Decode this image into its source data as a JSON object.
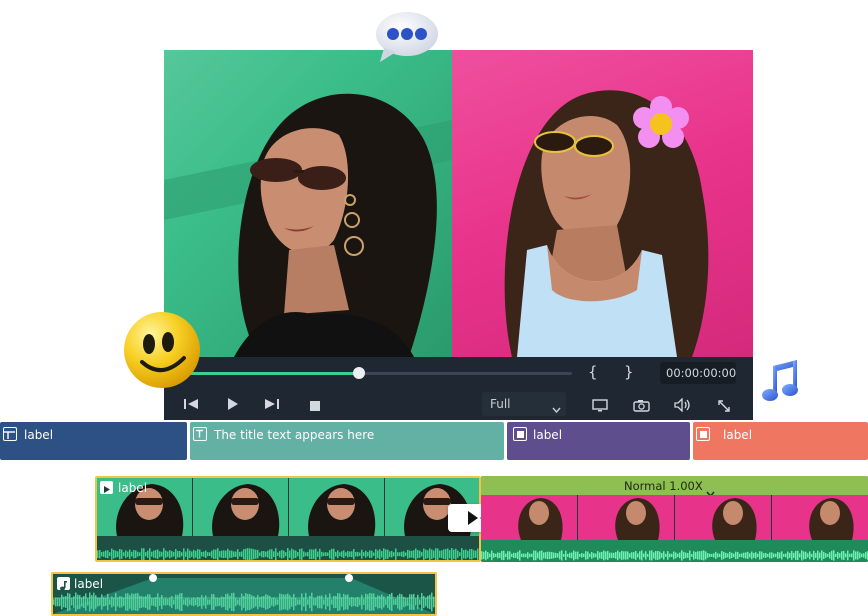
{
  "player": {
    "timecode": "00:00:00:00",
    "zoom_value": "Full",
    "mark_in_label": "{",
    "mark_out_label": "}",
    "progress": 0.45,
    "icons": [
      "step-back-icon",
      "play-icon",
      "step-forward-icon",
      "stop-icon",
      "chevron-down-icon",
      "display-icon",
      "camera-icon",
      "volume-icon",
      "fullscreen-icon"
    ]
  },
  "stickers": [
    "speech-bubble-sticker",
    "flower-sticker",
    "smiley-sticker",
    "music-note-sticker"
  ],
  "tracks": {
    "row1": [
      {
        "label": "label",
        "color": "#2d5185"
      },
      {
        "label": "The title text appears here",
        "color": "#63b0a4"
      },
      {
        "label": "label",
        "color": "#5e4e8e"
      },
      {
        "label": "label",
        "color": "#ef7762"
      }
    ],
    "video_clip_label": "label",
    "speed_label": "Normal 1.00X",
    "audio_clip_label": "label"
  },
  "colors": {
    "accent_green": "#3ecf8e",
    "selected_border": "#f3c443"
  }
}
